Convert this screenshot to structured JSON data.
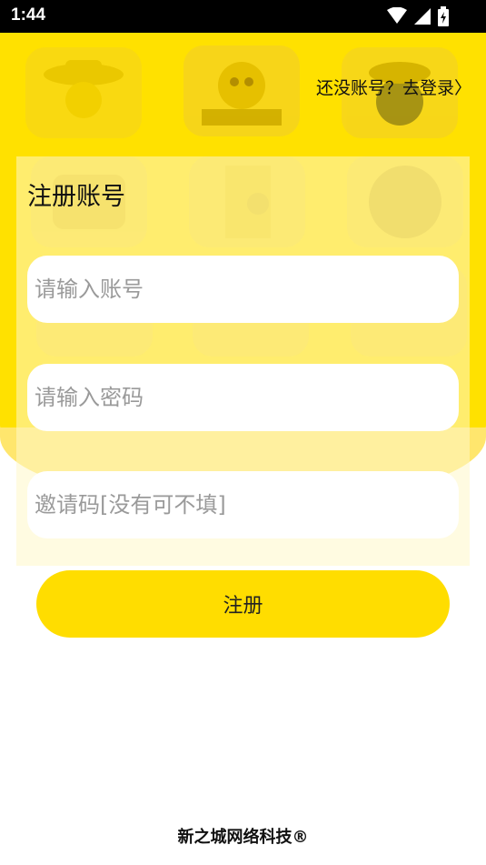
{
  "status_bar": {
    "time": "1:44",
    "icons": [
      "wifi-icon",
      "signal-icon",
      "battery-icon"
    ]
  },
  "header": {
    "login_link": "还没账号？去登录〉"
  },
  "form": {
    "title": "注册账号",
    "account_placeholder": "请输入账号",
    "password_placeholder": "请输入密码",
    "invite_placeholder": "邀请码[没有可不填]",
    "submit_label": "注册"
  },
  "footer": {
    "text": "新之城网络科技®"
  },
  "colors": {
    "accent": "#ffdd00",
    "hero": "#ffe100",
    "placeholder": "#9a9a9a"
  }
}
